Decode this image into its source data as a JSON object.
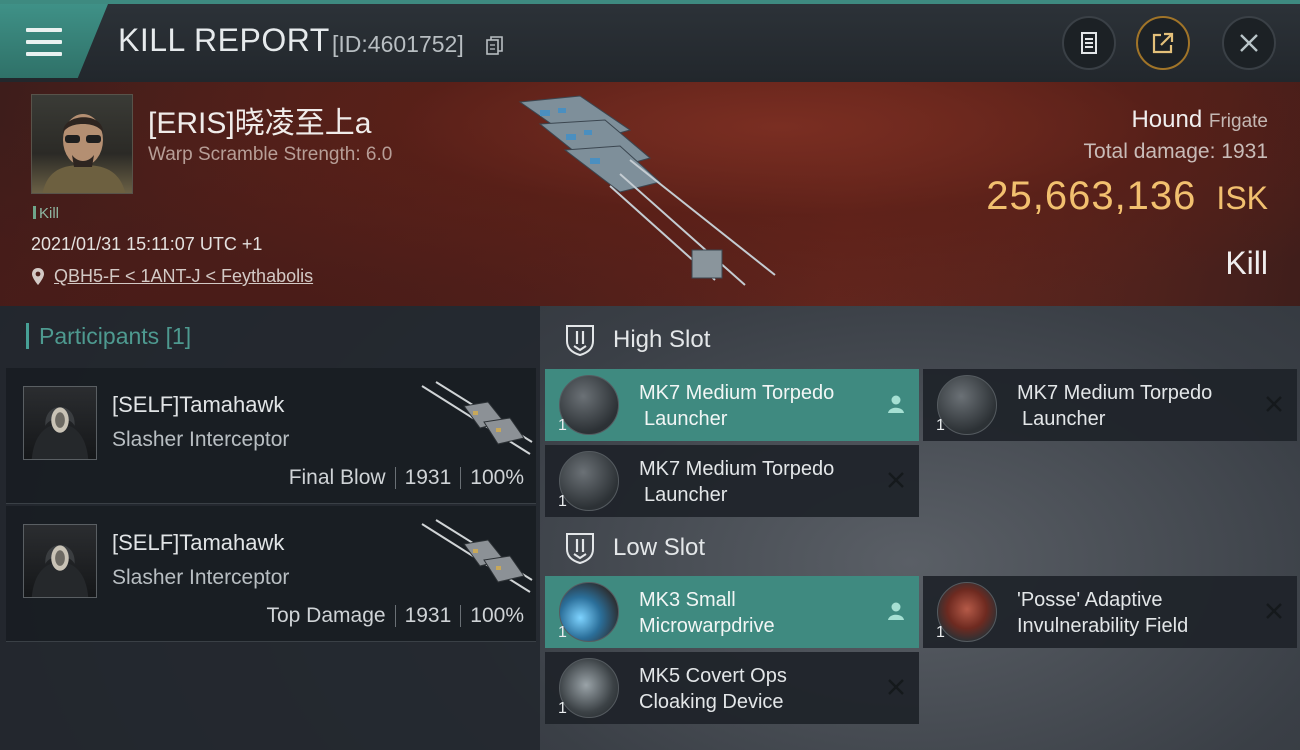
{
  "header": {
    "title": "KILL REPORT",
    "report_id": "[ID:4601752]"
  },
  "victim": {
    "name": "[ERIS]晓凌至上a",
    "warp_scramble": "Warp Scramble Strength: 6.0",
    "tag": "Kill",
    "datetime": "2021/01/31 15:11:07 UTC +1",
    "location": "QBH5-F < 1ANT-J < Feythabolis",
    "ship_name": "Hound",
    "ship_class": "Frigate",
    "total_damage_label": "Total damage:",
    "total_damage_value": "1931",
    "isk_value": "25,663,136",
    "isk_unit": "ISK",
    "result": "Kill"
  },
  "participants": {
    "title": "Participants",
    "count": "[1]",
    "items": [
      {
        "name": "[SELF]Tamahawk",
        "ship": "Slasher Interceptor",
        "label": "Final Blow",
        "damage": "1931",
        "percent": "100%"
      },
      {
        "name": "[SELF]Tamahawk",
        "ship": "Slasher Interceptor",
        "label": "Top Damage",
        "damage": "1931",
        "percent": "100%"
      }
    ]
  },
  "slots": {
    "high": {
      "label": "High Slot",
      "items": [
        {
          "qty": "1",
          "name_line1": "MK7 Medium Torpedo",
          "name_line2": "Launcher",
          "state": "self"
        },
        {
          "qty": "1",
          "name_line1": "MK7 Medium Torpedo",
          "name_line2": "Launcher",
          "state": "destroyed"
        },
        {
          "qty": "1",
          "name_line1": "MK7 Medium Torpedo",
          "name_line2": "Launcher",
          "state": "destroyed"
        }
      ]
    },
    "low": {
      "label": "Low Slot",
      "items": [
        {
          "qty": "1",
          "name_line1": "MK3 Small",
          "name_line2": "Microwarpdrive",
          "state": "self"
        },
        {
          "qty": "1",
          "name_line1": "'Posse' Adaptive",
          "name_line2": "Invulnerability Field",
          "state": "destroyed"
        },
        {
          "qty": "1",
          "name_line1": "MK5 Covert Ops",
          "name_line2": "Cloaking Device",
          "state": "destroyed"
        }
      ]
    }
  },
  "colors": {
    "accent": "#3f8a80",
    "isk": "#f2c06f",
    "participants_title": "#4e9a90"
  },
  "icons": [
    "menu-icon",
    "copy-icon",
    "clipboard-icon",
    "share-icon",
    "close-icon",
    "location-pin-icon",
    "high-slot-icon",
    "low-slot-icon",
    "pilot-icon",
    "x-mark-icon"
  ]
}
